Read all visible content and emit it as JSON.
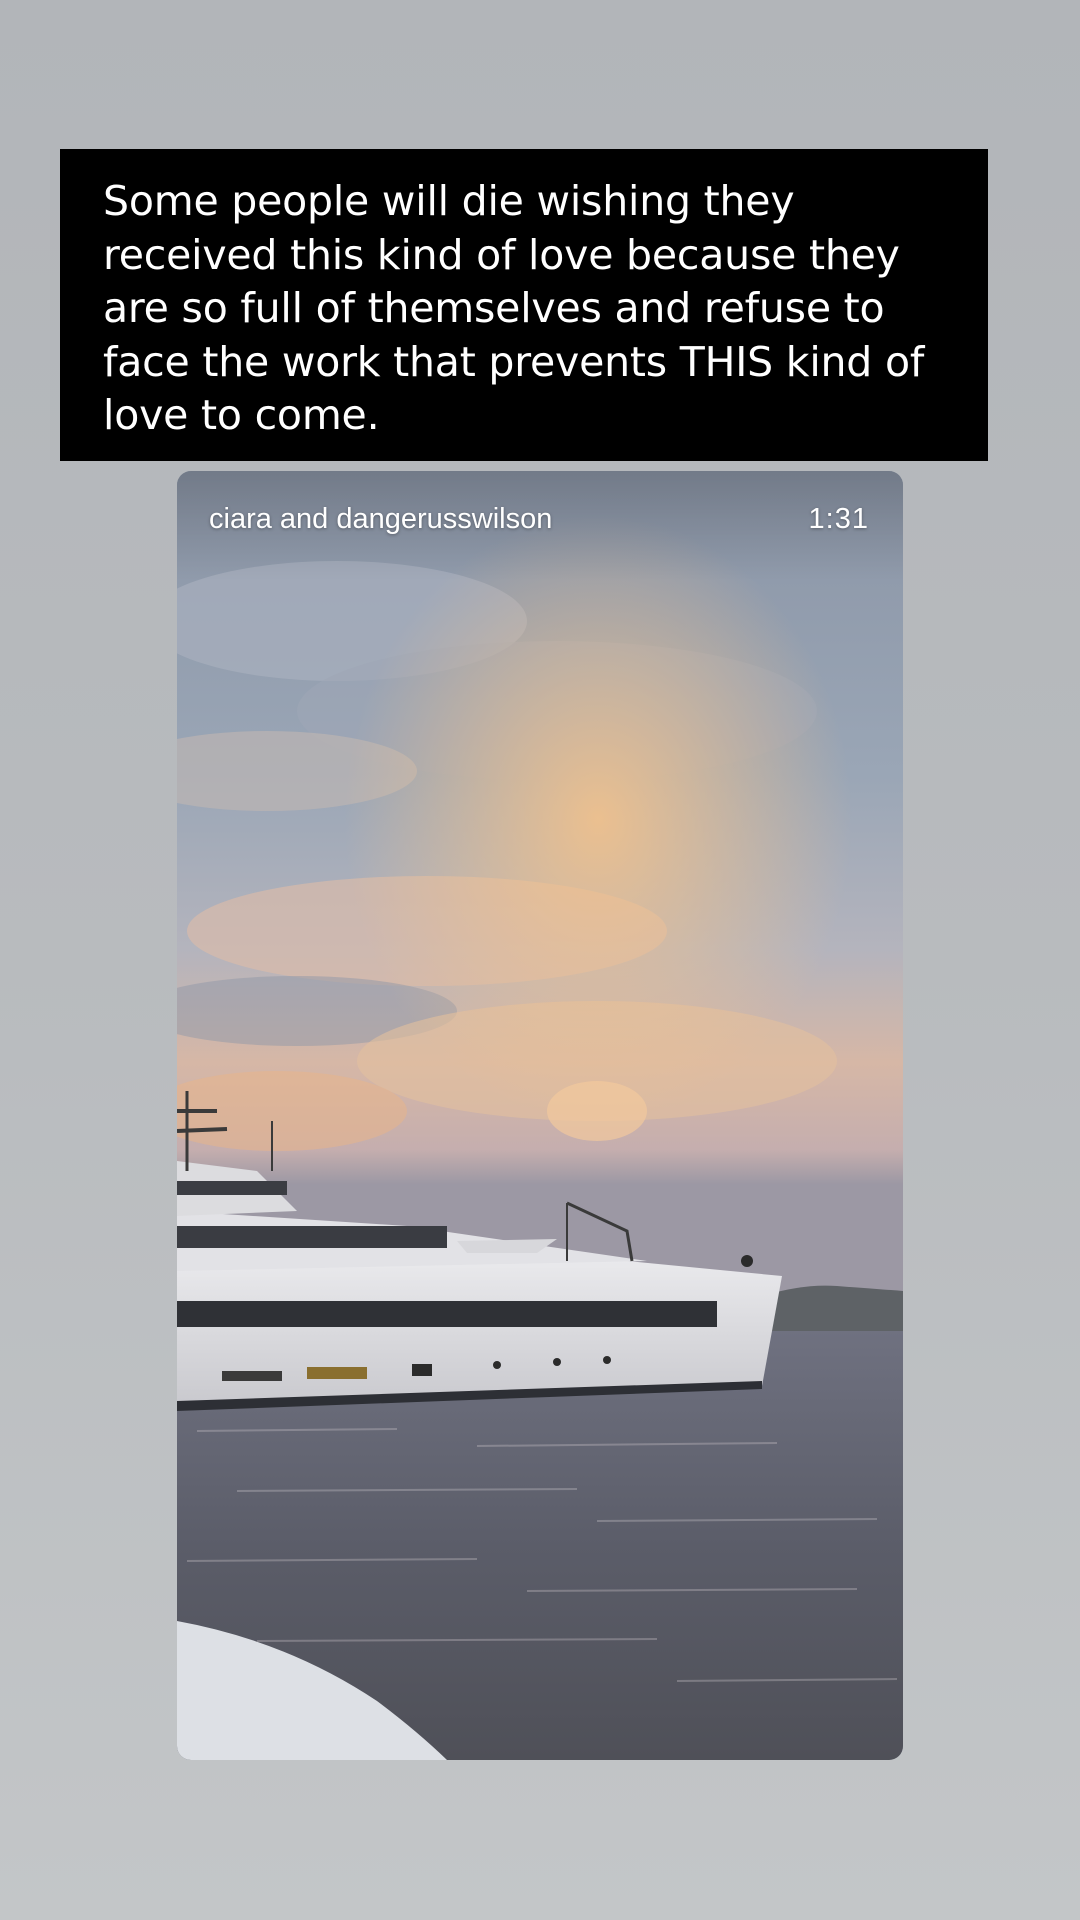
{
  "caption": {
    "text": "Some people will die wishing they\nreceived this kind of love because they\nare so full of themselves and refuse to\nface the work that prevents THIS kind of\nlove to come."
  },
  "media": {
    "author": "ciara and dangerusswilson",
    "duration": "1:31",
    "scene_description_icon": "video-thumbnail"
  },
  "colors": {
    "caption_bg": "#000000",
    "caption_text": "#ffffff",
    "page_bg": "#b8bbbe"
  }
}
